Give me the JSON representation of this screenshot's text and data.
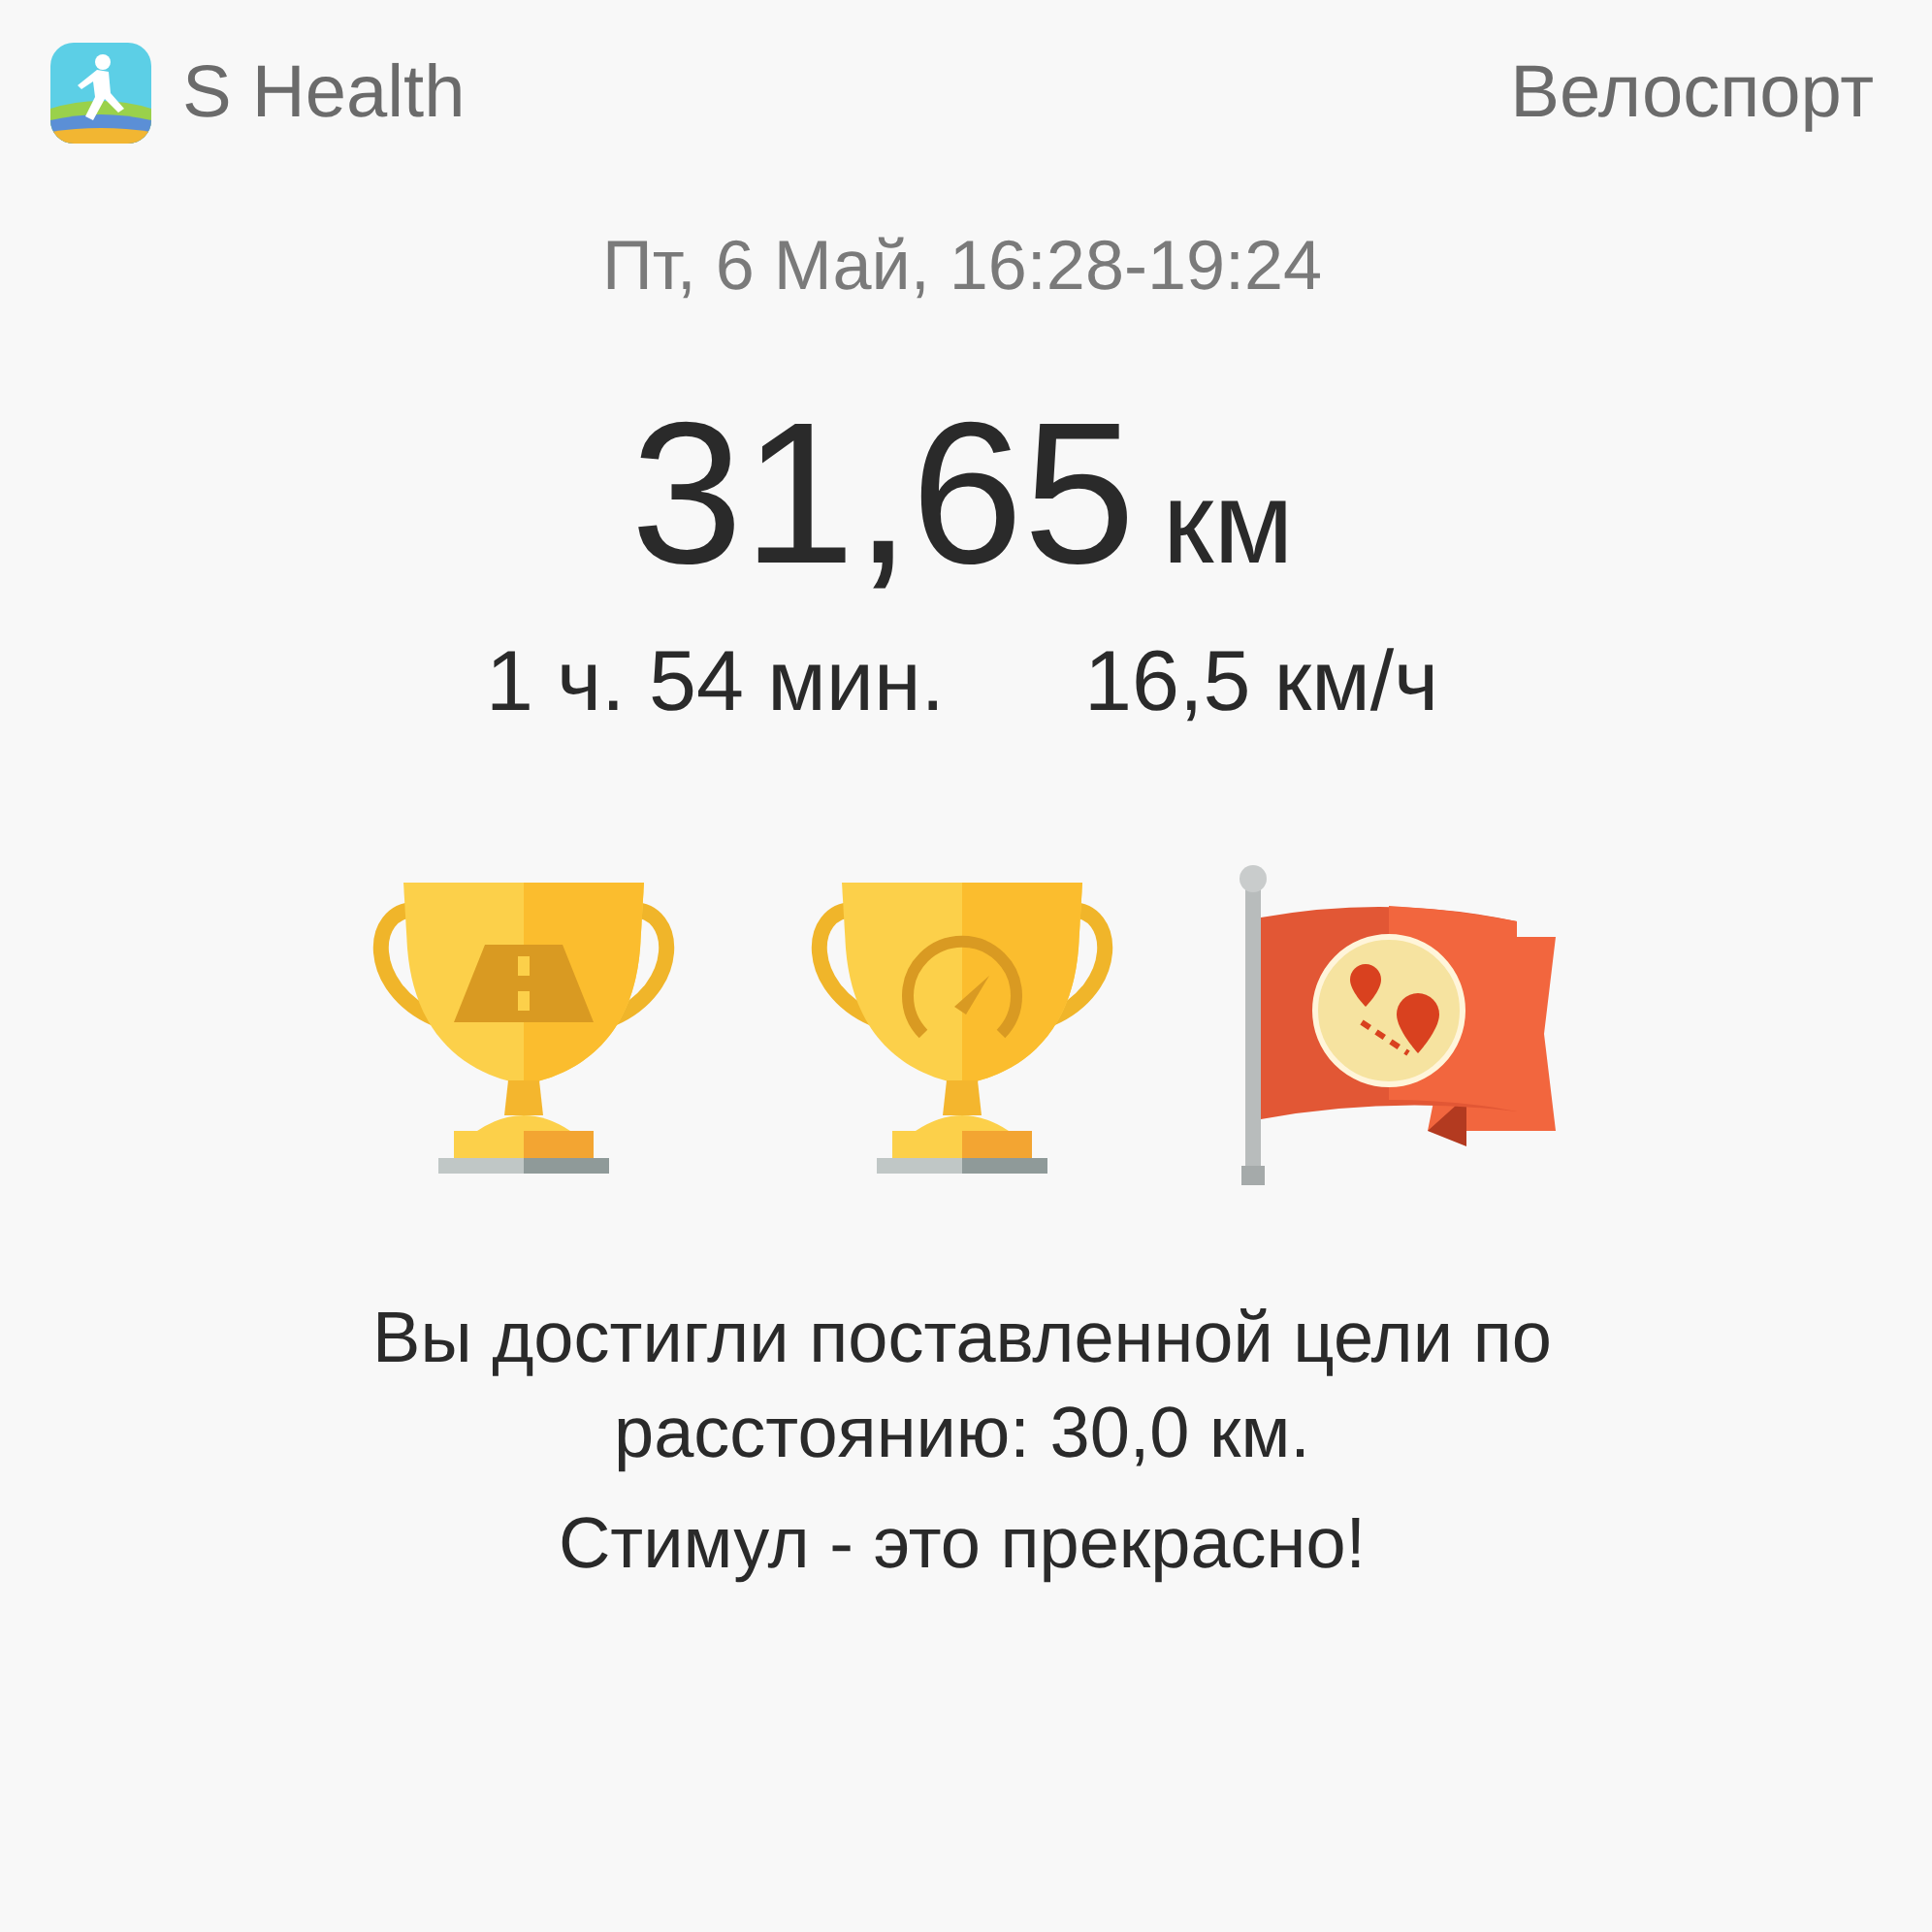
{
  "app": {
    "name": "S Health"
  },
  "activity": "Велоспорт",
  "date": "Пт, 6 Май, 16:28-19:24",
  "distance": {
    "value": "31,65",
    "unit": "км"
  },
  "stats": [
    "1 ч. 54 мин.",
    "16,5 км/ч"
  ],
  "awards": [
    {
      "kind": "trophy-road"
    },
    {
      "kind": "trophy-speed"
    },
    {
      "kind": "flag-route"
    }
  ],
  "message": [
    "Вы достигли поставленной цели по расстоянию: 30,0 км.",
    "Стимул - это прекрасно!"
  ]
}
